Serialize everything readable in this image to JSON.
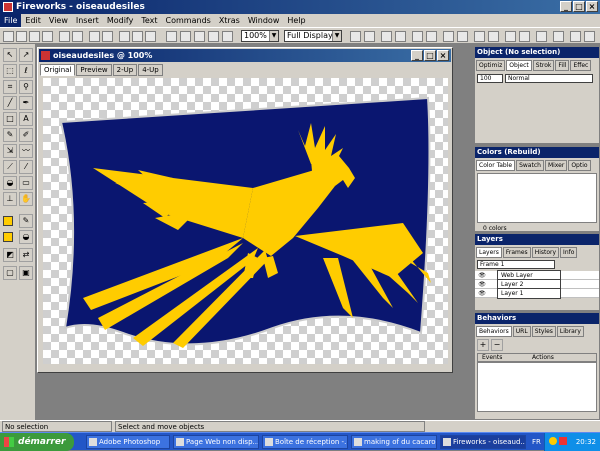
{
  "app": {
    "title": "Fireworks - oiseaudesiles"
  },
  "menu": [
    "File",
    "Edit",
    "View",
    "Insert",
    "Modify",
    "Text",
    "Commands",
    "Xtras",
    "Window",
    "Help"
  ],
  "toolbar": {
    "zoom": "100%",
    "display": "Full Display"
  },
  "document": {
    "title": "oiseaudesiles @ 100%",
    "tabs": [
      "Original",
      "Preview",
      "2-Up",
      "4-Up"
    ],
    "flag_color": "#0a1670",
    "bird_color": "#ffcc00"
  },
  "panels": {
    "object": {
      "title": "Object (No selection)",
      "tabs": [
        "Optimiz",
        "Object",
        "Strok",
        "Fill",
        "Effec"
      ],
      "opacity": "100",
      "blend": "Normal"
    },
    "colors": {
      "title": "Colors (Rebuild)",
      "tabs": [
        "Color Table",
        "Swatch",
        "Mixer",
        "Optio"
      ],
      "count": "0 colors"
    },
    "layers": {
      "title": "Layers",
      "tabs": [
        "Layers",
        "Frames",
        "History",
        "Info"
      ],
      "frame": "Frame 1",
      "items": [
        "Web Layer",
        "Layer 2",
        "Layer 1"
      ]
    },
    "behaviors": {
      "title": "Behaviors",
      "tabs": [
        "Behaviors",
        "URL",
        "Styles",
        "Library"
      ],
      "col_events": "Events",
      "col_actions": "Actions"
    }
  },
  "status": {
    "left": "No selection",
    "mid": "Select and move objects"
  },
  "taskbar": {
    "start": "démarrer",
    "tasks": [
      "Adobe Photoshop",
      "Page Web non disp...",
      "Boîte de réception -...",
      "making of du cacaro...",
      "Fireworks - oiseaud..."
    ],
    "lang": "FR",
    "clock": "20:32"
  }
}
